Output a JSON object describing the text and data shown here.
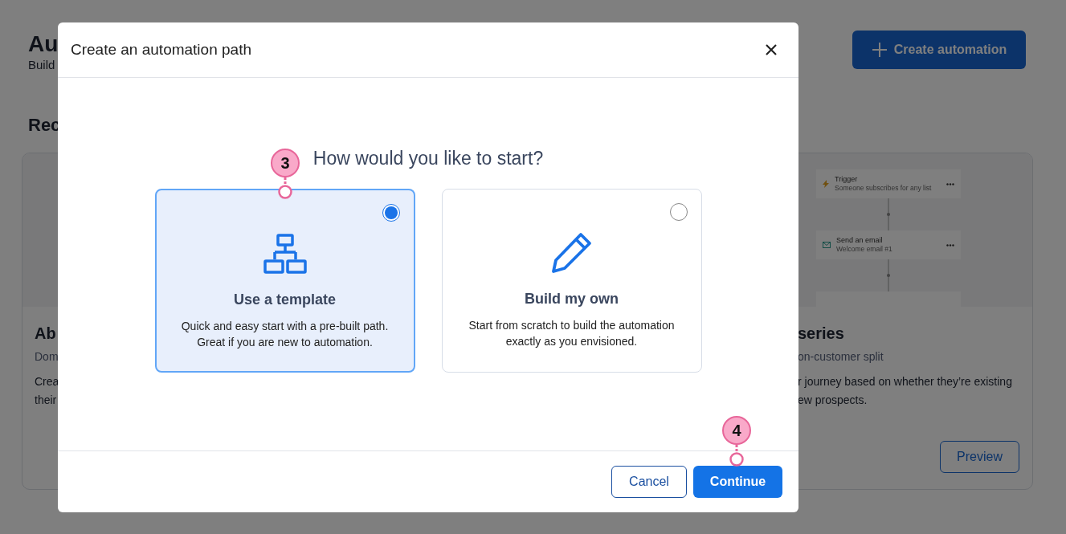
{
  "page": {
    "title": "Au",
    "subtitle": "Build",
    "create_button": "Create automation",
    "section_heading": "Rec",
    "cards": [
      {
        "title": "Ab",
        "category": "Dom",
        "description_lines": [
          "Crea",
          "their"
        ]
      },
      {
        "title": "series",
        "category": "on-customer split",
        "description_lines": [
          "r journey based on whether they’re existing",
          "ew prospects."
        ],
        "button": "Preview",
        "preview_steps": [
          {
            "kind": "trigger",
            "title": "Trigger",
            "subtitle": "Someone subscribes for any list"
          },
          {
            "kind": "email",
            "title": "Send an email",
            "subtitle": "Welcome email #1"
          }
        ]
      }
    ]
  },
  "dialog": {
    "title": "Create an automation path",
    "question": "How would you like to start?",
    "options": [
      {
        "kind": "template",
        "title": "Use a template",
        "description": "Quick and easy start with a pre-built path. Great if you are new to automation.",
        "selected": true
      },
      {
        "kind": "custom",
        "title": "Build my own",
        "description": "Start from scratch to build the automation exactly as you envisioned.",
        "selected": false
      }
    ],
    "buttons": [
      {
        "kind": "secondary",
        "label": "Cancel"
      },
      {
        "kind": "primary",
        "label": "Continue"
      }
    ]
  },
  "callouts": [
    {
      "label": "3"
    },
    {
      "label": "4"
    }
  ]
}
